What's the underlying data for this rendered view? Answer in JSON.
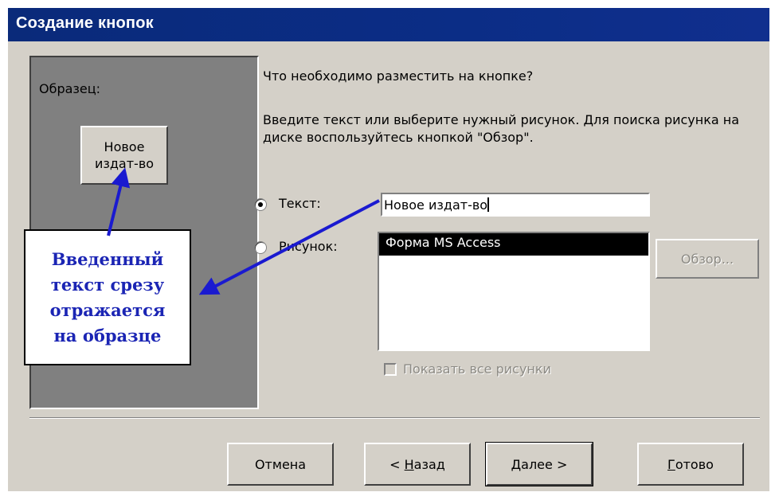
{
  "window": {
    "title": "Создание кнопок"
  },
  "sample": {
    "label": "Образец:",
    "button_line1": "Новое",
    "button_line2": "издат-во"
  },
  "callout": {
    "line1": "Введенный",
    "line2": "текст срезу",
    "line3": "отражается",
    "line4": "на образце"
  },
  "main": {
    "question": "Что необходимо разместить на кнопке?",
    "instruction": "Введите текст или выберите нужный рисунок.  Для поиска рисунка на диске воспользуйтесь кнопкой \"Обзор\".",
    "text_option_label": "Текст:",
    "text_value": "Новое издат-во",
    "picture_option_label": "Рисунок:",
    "picture_list": [
      "Форма MS Access"
    ],
    "browse_label": "Обзор...",
    "show_all_label": "Показать все рисунки"
  },
  "footer": {
    "cancel_label": "Отмена",
    "back_prefix": "< ",
    "back_key": "Н",
    "back_rest": "азад",
    "next_key": "Д",
    "next_rest": "алее >",
    "finish_key": "Г",
    "finish_rest": "отово"
  },
  "colors": {
    "titlebar": "#0a2a7a",
    "dialog_bg": "#d4d0c8",
    "sample_bg": "#808080",
    "callout_text": "#1b25b4",
    "arrow": "#1a1ad0",
    "selection": "#000000"
  }
}
